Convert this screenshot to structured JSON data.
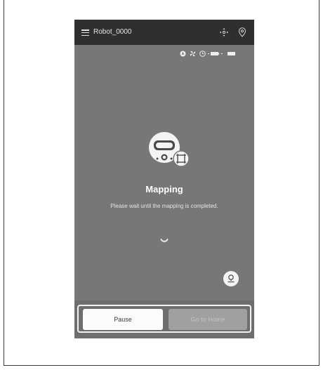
{
  "app": {
    "robot_name": "Robot_0000"
  },
  "status": {
    "title": "Mapping",
    "message": "Please wait until the mapping is completed."
  },
  "actions": {
    "pause_label": "Pause",
    "home_label": "Go to Home"
  },
  "icons": {
    "menu": "hamburger-menu-icon",
    "move": "move-arrows-icon",
    "location": "location-pin-icon",
    "status_bar": [
      "navigation-icon",
      "fan-icon",
      "clock-icon",
      "battery-icon",
      "water-tank-icon"
    ],
    "robot": "robot-vacuum-icon",
    "mapping_badge": "map-frame-icon",
    "spinner": "loading-spinner-icon",
    "map_button": "map-location-icon"
  },
  "colors": {
    "topbar": "#2f2f2f",
    "screen_background": "#777777",
    "primary_button": "#fbfbfb",
    "disabled_button": "#a0a0a0"
  }
}
